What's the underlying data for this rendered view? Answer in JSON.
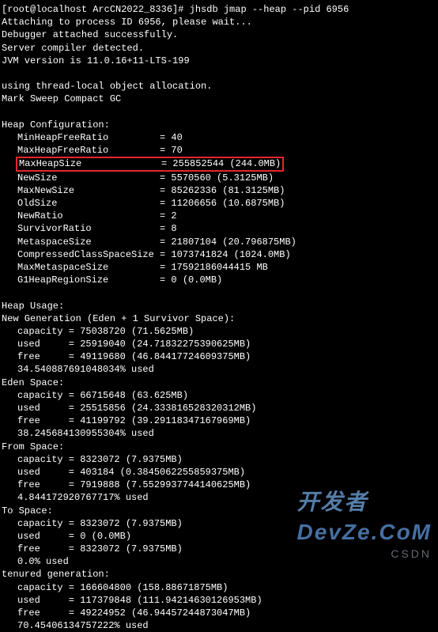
{
  "prompt": "[root@localhost ArcCN2022_8336]# jhsdb jmap --heap --pid 6956",
  "header": [
    "Attaching to process ID 6956, please wait...",
    "Debugger attached successfully.",
    "Server compiler detected.",
    "JVM version is 11.0.16+11-LTS-199",
    "",
    "using thread-local object allocation.",
    "Mark Sweep Compact GC"
  ],
  "heapConfig": {
    "title": "Heap Configuration:",
    "rows": [
      {
        "k": "MinHeapFreeRatio",
        "v": "= 40"
      },
      {
        "k": "MaxHeapFreeRatio",
        "v": "= 70"
      },
      {
        "k": "MaxHeapSize",
        "v": "= 255852544 (244.0MB)",
        "hl": true
      },
      {
        "k": "NewSize",
        "v": "= 5570560 (5.3125MB)"
      },
      {
        "k": "MaxNewSize",
        "v": "= 85262336 (81.3125MB)"
      },
      {
        "k": "OldSize",
        "v": "= 11206656 (10.6875MB)"
      },
      {
        "k": "NewRatio",
        "v": "= 2"
      },
      {
        "k": "SurvivorRatio",
        "v": "= 8"
      },
      {
        "k": "MetaspaceSize",
        "v": "= 21807104 (20.796875MB)"
      },
      {
        "k": "CompressedClassSpaceSize",
        "v": "= 1073741824 (1024.0MB)"
      },
      {
        "k": "MaxMetaspaceSize",
        "v": "= 17592186044415 MB"
      },
      {
        "k": "G1HeapRegionSize",
        "v": "= 0 (0.0MB)"
      }
    ]
  },
  "usage": {
    "title": "Heap Usage:",
    "sections": [
      {
        "name": "New Generation (Eden + 1 Survivor Space):",
        "rows": [
          {
            "k": "capacity",
            "v": "= 75038720 (71.5625MB)"
          },
          {
            "k": "used",
            "v": "= 25919040 (24.71832275390625MB)"
          },
          {
            "k": "free",
            "v": "= 49119680 (46.84417724609375MB)"
          }
        ],
        "pct": "34.540887691048034% used"
      },
      {
        "name": "Eden Space:",
        "rows": [
          {
            "k": "capacity",
            "v": "= 66715648 (63.625MB)"
          },
          {
            "k": "used",
            "v": "= 25515856 (24.333816528320312MB)"
          },
          {
            "k": "free",
            "v": "= 41199792 (39.29118347167969MB)"
          }
        ],
        "pct": "38.245684130955304% used"
      },
      {
        "name": "From Space:",
        "rows": [
          {
            "k": "capacity",
            "v": "= 8323072 (7.9375MB)"
          },
          {
            "k": "used",
            "v": "= 403184 (0.3845062255859375MB)"
          },
          {
            "k": "free",
            "v": "= 7919888 (7.5529937744140625MB)"
          }
        ],
        "pct": "4.844172920767717% used"
      },
      {
        "name": "To Space:",
        "rows": [
          {
            "k": "capacity",
            "v": "= 8323072 (7.9375MB)"
          },
          {
            "k": "used",
            "v": "= 0 (0.0MB)"
          },
          {
            "k": "free",
            "v": "= 8323072 (7.9375MB)"
          }
        ],
        "pct": "0.0% used"
      },
      {
        "name": "tenured generation:",
        "rows": [
          {
            "k": "capacity",
            "v": "= 166604800 (158.88671875MB)"
          },
          {
            "k": "used",
            "v": "= 117379848 (111.94214630126953MB)"
          },
          {
            "k": "free",
            "v": "= 49224952 (46.94457244873047MB)"
          }
        ],
        "pct": "70.45406134757222% used"
      }
    ]
  },
  "watermark": {
    "brand1": "开发",
    "brand2": "者",
    "brand3": "Dev",
    "brand4": "Ze.CoM",
    "csdn": "CSDN"
  }
}
